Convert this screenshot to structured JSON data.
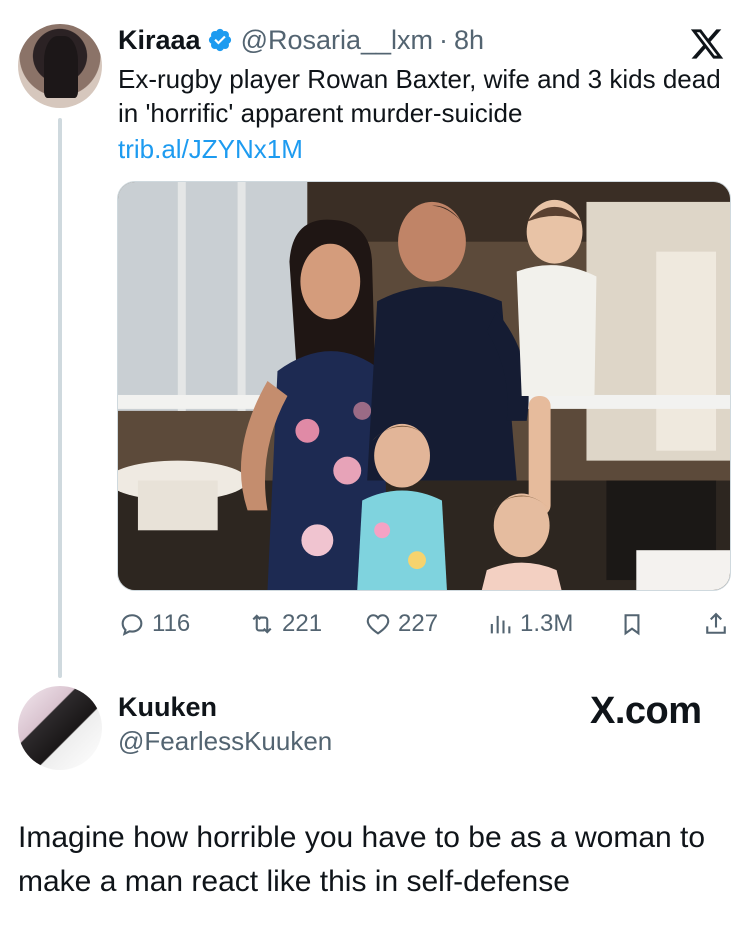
{
  "quoted_tweet": {
    "author_name": "Kiraaa",
    "handle": "@Rosaria__lxm",
    "separator": "·",
    "time": "8h",
    "text": "Ex-rugby player Rowan Baxter, wife and 3 kids dead in 'horrific' apparent murder-suicide",
    "link": "trib.al/JZYNx1M",
    "stats": {
      "replies": "116",
      "reposts": "221",
      "likes": "227",
      "views": "1.3M"
    },
    "icons": [
      "verified-badge-icon",
      "x-logo-icon",
      "reply-icon",
      "repost-icon",
      "like-icon",
      "views-icon",
      "bookmark-icon",
      "share-icon"
    ]
  },
  "reply_tweet": {
    "author_name": "Kuuken",
    "handle": "@FearlessKuuken",
    "watermark": "X.com",
    "text": "Imagine how horrible you have to be as a woman to make a man react like this in self-defense"
  },
  "colors": {
    "text": "#0f1419",
    "secondary": "#536471",
    "link": "#1d9bf0",
    "thread_line": "#cfd9de"
  }
}
